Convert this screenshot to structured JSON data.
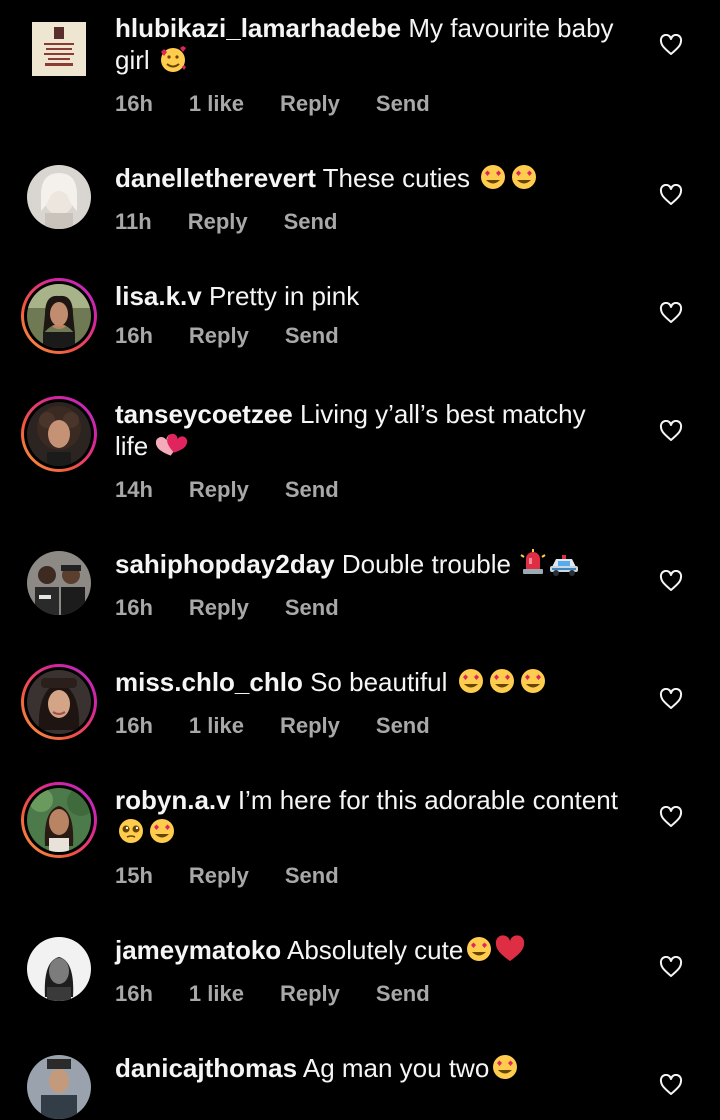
{
  "comments": [
    {
      "username": "hlubikazi_lamarhadebe",
      "text": "My favourite baby",
      "text2": "girl",
      "emoji": [
        "smiling-face-with-hearts"
      ],
      "time": "16h",
      "likes": "1 like",
      "reply": "Reply",
      "send": "Send",
      "avatar": "book-cover"
    },
    {
      "username": "danelletherevert",
      "text": "These cuties",
      "emoji": [
        "heart-eyes",
        "heart-eyes"
      ],
      "time": "11h",
      "reply": "Reply",
      "send": "Send",
      "avatar": "photo"
    },
    {
      "username": "lisa.k.v",
      "text": "Pretty in pink",
      "emoji": [],
      "time": "16h",
      "reply": "Reply",
      "send": "Send",
      "avatar": "photo-story"
    },
    {
      "username": "tanseycoetzee",
      "text": "Living y’all’s best matchy",
      "text2": "life",
      "emoji": [
        "two-hearts"
      ],
      "time": "14h",
      "reply": "Reply",
      "send": "Send",
      "avatar": "photo-story"
    },
    {
      "username": "sahiphopday2day",
      "text": "Double trouble",
      "emoji": [
        "police-light",
        "police-car"
      ],
      "time": "16h",
      "reply": "Reply",
      "send": "Send",
      "avatar": "photo"
    },
    {
      "username": "miss.chlo_chlo",
      "text": "So beautiful",
      "emoji": [
        "heart-eyes",
        "heart-eyes",
        "heart-eyes"
      ],
      "time": "16h",
      "likes": "1 like",
      "reply": "Reply",
      "send": "Send",
      "avatar": "photo-story"
    },
    {
      "username": "robyn.a.v",
      "text": "I’m here for this adorable content",
      "emoji": [
        "pleading-face",
        "heart-eyes"
      ],
      "time": "15h",
      "reply": "Reply",
      "send": "Send",
      "avatar": "photo-story"
    },
    {
      "username": "jameymatoko",
      "text": "Absolutely cute",
      "emoji": [
        "heart-eyes",
        "red-heart"
      ],
      "time": "16h",
      "likes": "1 like",
      "reply": "Reply",
      "send": "Send",
      "avatar": "photo"
    },
    {
      "username": "danicajthomas",
      "text": "Ag man you two",
      "emoji": [
        "heart-eyes"
      ],
      "avatar": "photo"
    }
  ],
  "colors": {
    "background": "#000000",
    "text": "#f5f5f5",
    "meta": "#a8a8a8",
    "story_ring_start": "#f9a03f",
    "story_ring_end": "#b22fc9"
  }
}
